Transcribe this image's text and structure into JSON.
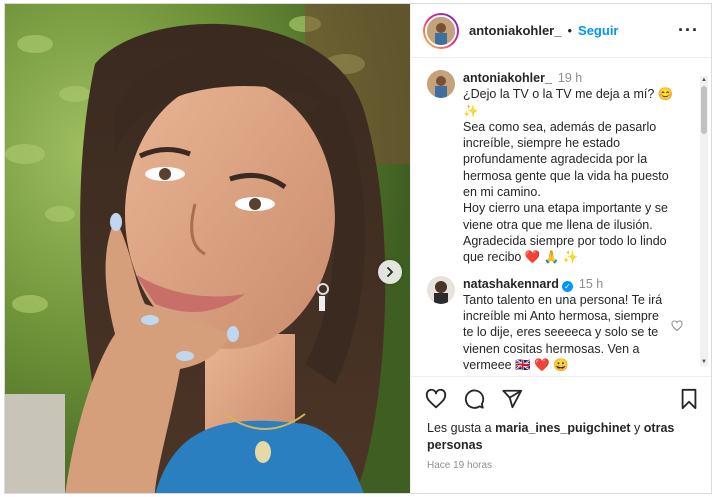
{
  "post": {
    "username": "antoniakohler_",
    "follow_label": "Seguir",
    "more_label": "···",
    "separator": "•"
  },
  "caption": {
    "username": "antoniakohler_",
    "time": "19 h",
    "text": "¿Dejo la TV o la TV me deja a mí? 😊\n✨\nSea como sea, además de pasarlo\nincreíble, siempre he estado\nprofundamente agradecida por la\nhermosa gente que la vida ha puesto\nen mi camino.\nHoy cierro una etapa importante y se\nviene otra que me llena de ilusión.\nAgradecida siempre por todo lo lindo\nque recibo ❤️ 🙏 ✨"
  },
  "comments": [
    {
      "username": "natashakennard",
      "verified": true,
      "time": "15 h",
      "text": "Tanto talento en una persona! Te irá\nincreíble mi Anto hermosa, siempre\nte lo dije, eres seeeeca y solo se te\nvienen cositas hermosas. Ven a\nvermeee 🇬🇧 ❤️ 😀"
    }
  ],
  "likes": {
    "prefix": "Les gusta a ",
    "user": "maria_ines_puigchinet",
    "middle": " y ",
    "others": "otras personas"
  },
  "date_label": "Hace 19 horas",
  "icons": {
    "like": "heart-outline-icon",
    "comment": "comment-bubble-icon",
    "share": "paper-plane-icon",
    "save": "bookmark-icon",
    "next": "chevron-right-icon"
  },
  "colors": {
    "accent": "#0095f6",
    "text": "#262626",
    "muted": "#8e8e8e"
  }
}
